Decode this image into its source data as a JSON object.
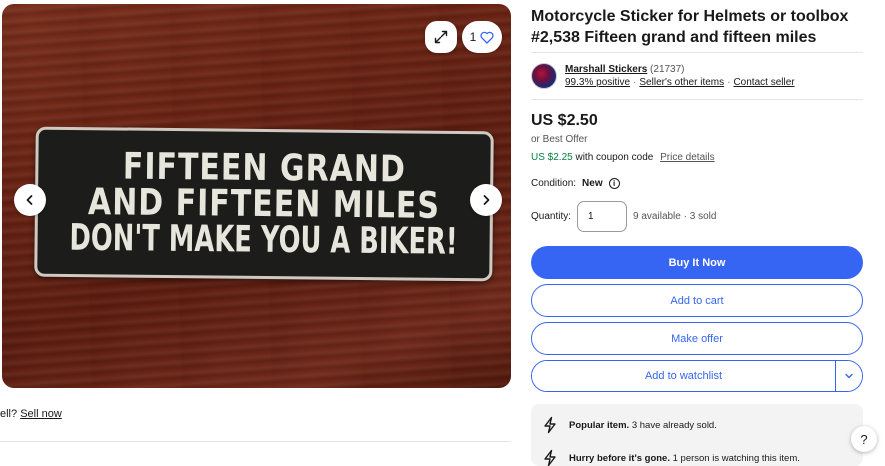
{
  "gallery": {
    "sticker_lines": [
      "FIFTEEN GRAND",
      "AND FIFTEEN MILES",
      "DON'T MAKE YOU A BIKER!"
    ],
    "watch_count": "1",
    "icons": {
      "expand": "expand-icon",
      "heart": "heart-icon",
      "prev": "chevron-left-icon",
      "next": "chevron-right-icon"
    }
  },
  "sell_prompt": {
    "prefix": "ell?",
    "link": "Sell now"
  },
  "listing": {
    "title": "Motorcycle Sticker for Helmets or toolbox #2,538 Fifteen grand and fifteen miles"
  },
  "seller": {
    "name": "Marshall Stickers",
    "feedback_count": "(21737)",
    "positive": "99.3% positive",
    "other_items": "Seller's other items",
    "contact": "Contact seller"
  },
  "pricing": {
    "price": "US $2.50",
    "best_offer": "or Best Offer",
    "coupon_price": "US $2.25",
    "coupon_text": "with coupon code",
    "price_details": "Price details"
  },
  "condition": {
    "label": "Condition:",
    "value": "New"
  },
  "quantity": {
    "label": "Quantity:",
    "value": "1",
    "availability": "9 available · 3 sold"
  },
  "actions": {
    "buy_now": "Buy It Now",
    "add_to_cart": "Add to cart",
    "make_offer": "Make offer",
    "add_to_watchlist": "Add to watchlist"
  },
  "signals": [
    {
      "bold": "Popular item.",
      "text": "3 have already sold."
    },
    {
      "bold": "Hurry before it's gone.",
      "text": "1 person is watching this item."
    }
  ],
  "help": {
    "label": "?"
  },
  "colors": {
    "accent": "#3665f3",
    "coupon_green": "#05823f"
  }
}
